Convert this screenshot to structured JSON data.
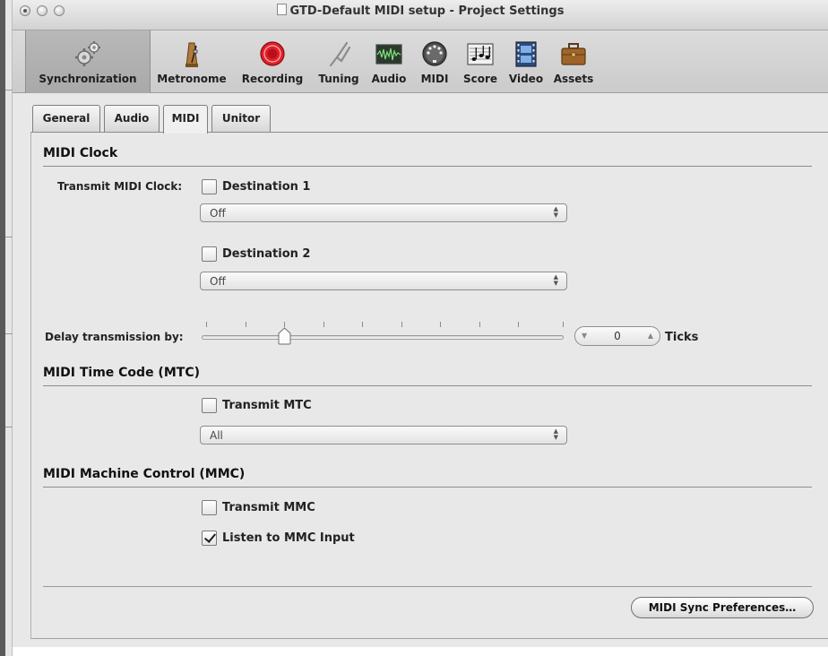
{
  "window": {
    "title": "GTD-Default MIDI setup - Project Settings"
  },
  "toolbar": {
    "items": [
      {
        "label": "Synchronization",
        "icon": "gears-icon"
      },
      {
        "label": "Metronome",
        "icon": "metronome-icon"
      },
      {
        "label": "Recording",
        "icon": "record-icon"
      },
      {
        "label": "Tuning",
        "icon": "tuning-fork-icon"
      },
      {
        "label": "Audio",
        "icon": "waveform-icon"
      },
      {
        "label": "MIDI",
        "icon": "midi-port-icon"
      },
      {
        "label": "Score",
        "icon": "score-icon"
      },
      {
        "label": "Video",
        "icon": "film-icon"
      },
      {
        "label": "Assets",
        "icon": "briefcase-icon"
      }
    ],
    "selected": "Synchronization"
  },
  "tabs": [
    {
      "label": "General"
    },
    {
      "label": "Audio"
    },
    {
      "label": "MIDI"
    },
    {
      "label": "Unitor"
    }
  ],
  "active_tab": "MIDI",
  "midi_clock": {
    "title": "MIDI Clock",
    "transmit_label": "Transmit MIDI Clock:",
    "destination1": {
      "label": "Destination 1",
      "checked": false,
      "value": "Off"
    },
    "destination2": {
      "label": "Destination 2",
      "checked": false,
      "value": "Off"
    },
    "delay_label": "Delay transmission by:",
    "delay_value": "0",
    "delay_unit": "Ticks"
  },
  "mtc": {
    "title": "MIDI Time Code (MTC)",
    "transmit_label": "Transmit MTC",
    "checked": false,
    "value": "All"
  },
  "mmc": {
    "title": "MIDI Machine Control (MMC)",
    "transmit_label": "Transmit MMC",
    "transmit_checked": false,
    "listen_label": "Listen to MMC Input",
    "listen_checked": true
  },
  "footer": {
    "prefs_button": "MIDI Sync Preferences…"
  },
  "colors": {
    "record_red": "#e0202a",
    "window_bg": "#e8e8e8"
  }
}
